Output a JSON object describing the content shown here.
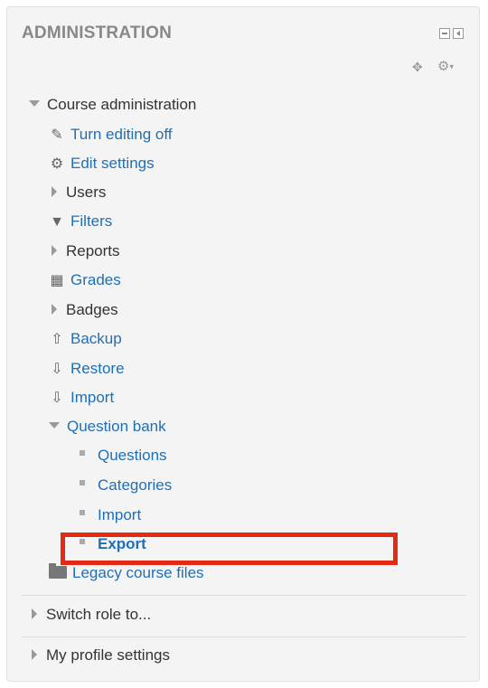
{
  "block": {
    "title": "ADMINISTRATION"
  },
  "tree": {
    "course_admin": "Course administration",
    "turn_editing_off": "Turn editing off",
    "edit_settings": "Edit settings",
    "users": "Users",
    "filters": "Filters",
    "reports": "Reports",
    "grades": "Grades",
    "badges": "Badges",
    "backup": "Backup",
    "restore": "Restore",
    "import": "Import",
    "question_bank": "Question bank",
    "qb_questions": "Questions",
    "qb_categories": "Categories",
    "qb_import": "Import",
    "qb_export": "Export",
    "legacy_files": "Legacy course files"
  },
  "bottom": {
    "switch_role": "Switch role to...",
    "profile_settings": "My profile settings"
  },
  "icons": {
    "dock": "dock-icon",
    "hide": "hide-icon",
    "move": "move-icon",
    "actions": "gear-icon",
    "pencil": "pencil-icon",
    "gear": "gear-icon",
    "filter": "filter-icon",
    "grades": "table-icon",
    "upload": "upload-icon",
    "download": "download-icon",
    "folder": "folder-icon"
  },
  "colors": {
    "link": "#1f6fb5",
    "highlight_border": "#e42a14",
    "title": "#888888",
    "panel_bg": "#f4f4f4"
  }
}
